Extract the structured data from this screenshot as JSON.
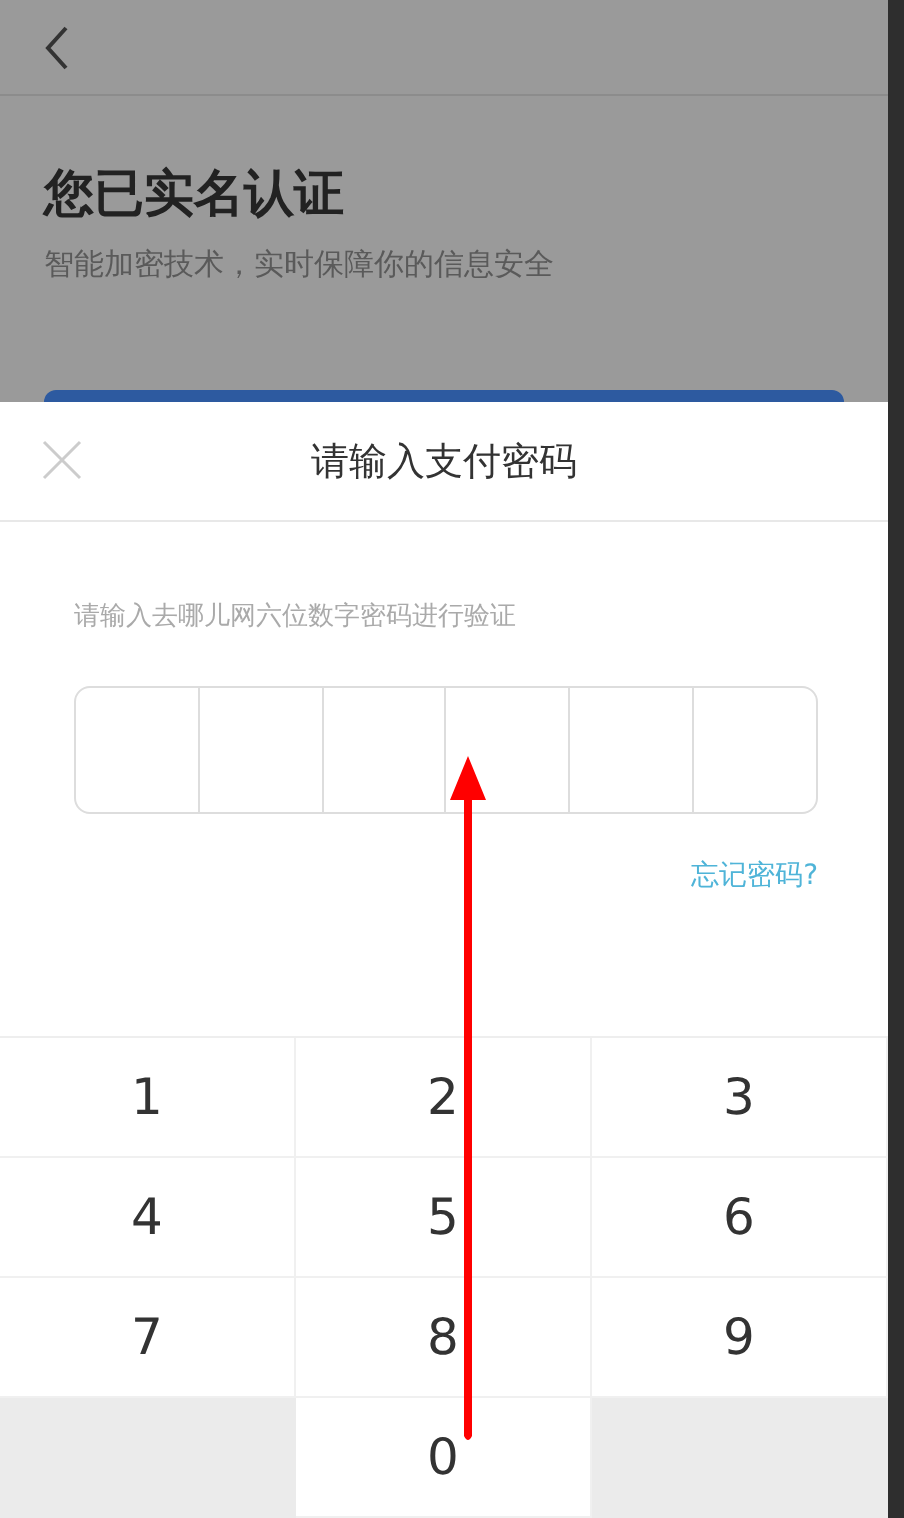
{
  "background_page": {
    "title": "您已实名认证",
    "subtitle": "智能加密技术，实时保障你的信息安全"
  },
  "dialog": {
    "title": "请输入支付密码",
    "hint": "请输入去哪儿网六位数字密码进行验证",
    "pin_cells": [
      {
        "filled": false
      },
      {
        "filled": false
      },
      {
        "filled": false
      },
      {
        "filled": false
      },
      {
        "filled": false
      },
      {
        "filled": false
      }
    ],
    "forgot_link": "忘记密码?"
  },
  "keypad": [
    {
      "kind": "digit",
      "label": "1"
    },
    {
      "kind": "digit",
      "label": "2"
    },
    {
      "kind": "digit",
      "label": "3"
    },
    {
      "kind": "digit",
      "label": "4"
    },
    {
      "kind": "digit",
      "label": "5"
    },
    {
      "kind": "digit",
      "label": "6"
    },
    {
      "kind": "digit",
      "label": "7"
    },
    {
      "kind": "digit",
      "label": "8"
    },
    {
      "kind": "digit",
      "label": "9"
    },
    {
      "kind": "blank"
    },
    {
      "kind": "digit",
      "label": "0"
    },
    {
      "kind": "blank"
    }
  ]
}
